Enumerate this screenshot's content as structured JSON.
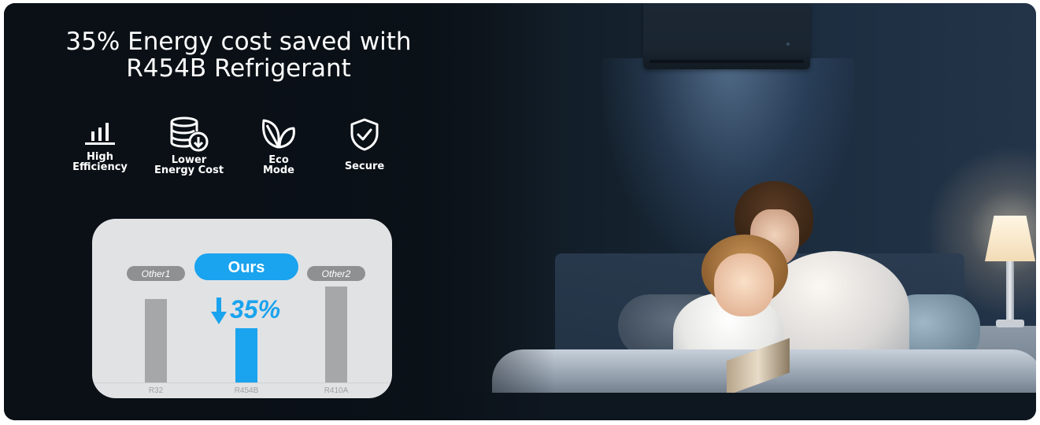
{
  "headline": {
    "line1": "35% Energy cost saved with",
    "line2": "R454B Refrigerant"
  },
  "features": [
    {
      "icon": "bar-chart-icon",
      "line1": "High",
      "line2": "Efficiency"
    },
    {
      "icon": "coins-download-icon",
      "line1": "Lower",
      "line2": "Energy Cost"
    },
    {
      "icon": "leaf-icon",
      "line1": "Eco",
      "line2": "Mode"
    },
    {
      "icon": "shield-check-icon",
      "line1": "Secure",
      "line2": ""
    }
  ],
  "chart_data": {
    "type": "bar",
    "categories": [
      "R32",
      "R454B",
      "R410A"
    ],
    "badges": [
      "Other1",
      "Ours",
      "Other2"
    ],
    "values": [
      100,
      65,
      115
    ],
    "highlight_index": 1,
    "annotation": "35%",
    "colors": {
      "other": "#a6a7a9",
      "ours": "#1aa3ee",
      "badge_other": "#8f9091",
      "badge_ours": "#1aa3ee"
    },
    "title": "",
    "xlabel": "",
    "ylabel": ""
  }
}
